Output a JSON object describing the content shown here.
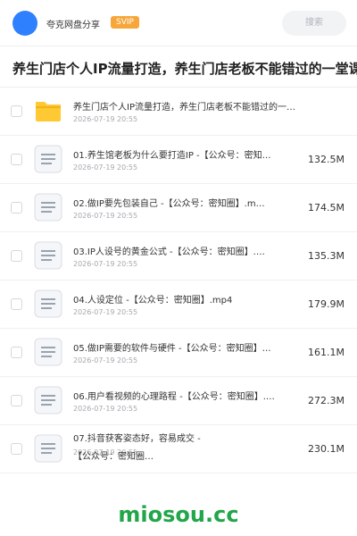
{
  "header": {
    "user_name": "夸克网盘分享",
    "vip_badge": "SVIP",
    "search_placeholder": "搜索"
  },
  "folder_title": "养生门店个人IP流量打造，养生门店老板不能错过的一堂课",
  "items": [
    {
      "name": "养生门店个人IP流量打造，养生门店老板不能错过的一…",
      "date": "2026-07-19 20:55",
      "size": "",
      "type": "folder"
    },
    {
      "name": "01.养生馆老板为什么要打造IP -【公众号：密知…",
      "date": "2026-07-19 20:55",
      "size": "132.5M",
      "type": "file"
    },
    {
      "name": "02.做IP要先包装自己 -【公众号：密知圈】.m…",
      "date": "2026-07-19 20:55",
      "size": "174.5M",
      "type": "file"
    },
    {
      "name": "03.IP人设号的黄金公式 -【公众号：密知圈】.…",
      "date": "2026-07-19 20:55",
      "size": "135.3M",
      "type": "file"
    },
    {
      "name": "04.人设定位 -【公众号：密知圈】.mp4",
      "date": "2026-07-19 20:55",
      "size": "179.9M",
      "type": "file"
    },
    {
      "name": "05.做IP需要的软件与硬件 -【公众号：密知圈】…",
      "date": "2026-07-19 20:55",
      "size": "161.1M",
      "type": "file"
    },
    {
      "name": "06.用户看视频的心理路程 -【公众号：密知圈】.…",
      "date": "2026-07-19 20:55",
      "size": "272.3M",
      "type": "file"
    },
    {
      "name": "07.抖音获客姿态好，容易成交 -【公众号：密知圈…",
      "date": "2026-07-19 20:55",
      "size": "230.1M",
      "type": "file"
    }
  ],
  "watermark": "miosou.cc",
  "colors": {
    "accent": "#2f80ff",
    "vip": "#f7a63a",
    "folder": "#ffc933",
    "watermark": "#22a64a"
  }
}
